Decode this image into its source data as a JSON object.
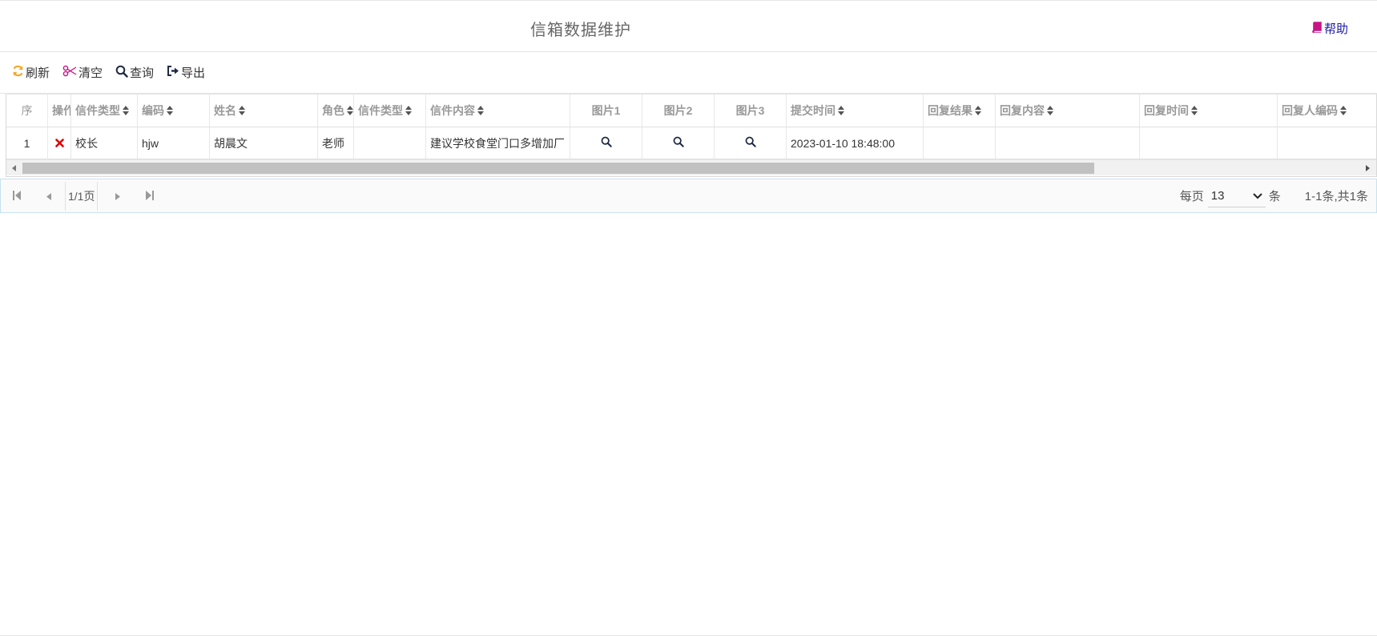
{
  "header": {
    "title": "信箱数据维护",
    "help_label": "帮助"
  },
  "toolbar": {
    "refresh": "刷新",
    "clear": "清空",
    "query": "查询",
    "export": "导出"
  },
  "table": {
    "columns": [
      "序",
      "操作",
      "信件类型",
      "编码",
      "姓名",
      "角色",
      "信件类型",
      "信件内容",
      "图片1",
      "图片2",
      "图片3",
      "提交时间",
      "回复结果",
      "回复内容",
      "回复时间",
      "回复人编码"
    ],
    "rows": [
      {
        "seq": "1",
        "type": "校长",
        "code": "hjw",
        "name": "胡晨文",
        "role": "老师",
        "type2": "",
        "content": "建议学校食堂门口多增加厂",
        "time": "2023-01-10 18:48:00",
        "reply_result": "",
        "reply_content": "",
        "reply_time": "",
        "reply_code": ""
      }
    ]
  },
  "pager": {
    "page_info": "1/1页",
    "per_page_label": "每页",
    "per_page_value": "13",
    "unit": "条",
    "count_text": "1-1条,共1条"
  },
  "colors": {
    "accent_orange": "#f5a623",
    "clear_pink": "#c71585",
    "delete_red": "#e00000",
    "help_blue": "#1a1aa6"
  }
}
